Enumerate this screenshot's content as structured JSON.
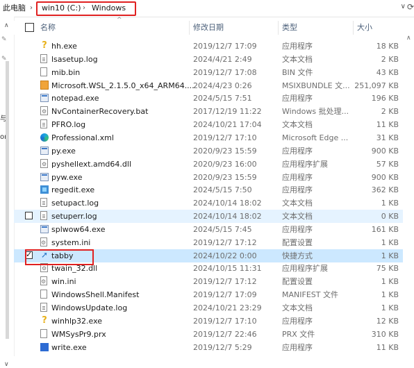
{
  "address": {
    "root": "此电脑",
    "drive": "win10 (C:)",
    "folder": "Windows"
  },
  "navpane": {
    "label1": "与",
    "label2": "on"
  },
  "columns": {
    "name": "名称",
    "date": "修改日期",
    "type": "类型",
    "size": "大小"
  },
  "files": [
    {
      "name": "hh.exe",
      "date": "2019/12/7 17:09",
      "type": "应用程序",
      "size": "18 KB",
      "icon": "help-exe-icon"
    },
    {
      "name": "lsasetup.log",
      "date": "2024/4/21 2:49",
      "type": "文本文档",
      "size": "2 KB",
      "icon": "text-file-icon"
    },
    {
      "name": "mib.bin",
      "date": "2019/12/7 17:08",
      "type": "BIN 文件",
      "size": "43 KB",
      "icon": "file-icon"
    },
    {
      "name": "Microsoft.WSL_2.1.5.0_x64_ARM64....",
      "date": "2024/4/23 0:26",
      "type": "MSIXBUNDLE 文...",
      "size": "251,097 KB",
      "icon": "package-icon"
    },
    {
      "name": "notepad.exe",
      "date": "2024/5/15 7:51",
      "type": "应用程序",
      "size": "196 KB",
      "icon": "app-icon"
    },
    {
      "name": "NvContainerRecovery.bat",
      "date": "2017/12/19 11:22",
      "type": "Windows 批处理...",
      "size": "2 KB",
      "icon": "batch-file-icon"
    },
    {
      "name": "PFRO.log",
      "date": "2024/10/21 17:04",
      "type": "文本文档",
      "size": "11 KB",
      "icon": "text-file-icon"
    },
    {
      "name": "Professional.xml",
      "date": "2019/12/7 17:10",
      "type": "Microsoft Edge ...",
      "size": "31 KB",
      "icon": "edge-icon"
    },
    {
      "name": "py.exe",
      "date": "2020/9/23 15:59",
      "type": "应用程序",
      "size": "900 KB",
      "icon": "python-icon"
    },
    {
      "name": "pyshellext.amd64.dll",
      "date": "2020/9/23 16:00",
      "type": "应用程序扩展",
      "size": "57 KB",
      "icon": "dll-icon"
    },
    {
      "name": "pyw.exe",
      "date": "2020/9/23 15:59",
      "type": "应用程序",
      "size": "900 KB",
      "icon": "python-icon"
    },
    {
      "name": "regedit.exe",
      "date": "2024/5/15 7:50",
      "type": "应用程序",
      "size": "362 KB",
      "icon": "regedit-icon"
    },
    {
      "name": "setupact.log",
      "date": "2024/10/14 18:02",
      "type": "文本文档",
      "size": "1 KB",
      "icon": "text-file-icon"
    },
    {
      "name": "setuperr.log",
      "date": "2024/10/14 18:02",
      "type": "文本文档",
      "size": "0 KB",
      "icon": "text-file-icon"
    },
    {
      "name": "splwow64.exe",
      "date": "2024/5/15 7:45",
      "type": "应用程序",
      "size": "161 KB",
      "icon": "printer-icon"
    },
    {
      "name": "system.ini",
      "date": "2019/12/7 17:12",
      "type": "配置设置",
      "size": "1 KB",
      "icon": "ini-file-icon"
    },
    {
      "name": "tabby",
      "date": "2024/10/22 0:00",
      "type": "快捷方式",
      "size": "1 KB",
      "icon": "shortcut-icon"
    },
    {
      "name": "twain_32.dll",
      "date": "2024/10/15 11:31",
      "type": "应用程序扩展",
      "size": "75 KB",
      "icon": "dll-icon"
    },
    {
      "name": "win.ini",
      "date": "2019/12/7 17:12",
      "type": "配置设置",
      "size": "1 KB",
      "icon": "ini-file-icon"
    },
    {
      "name": "WindowsShell.Manifest",
      "date": "2019/12/7 17:09",
      "type": "MANIFEST 文件",
      "size": "1 KB",
      "icon": "file-icon"
    },
    {
      "name": "WindowsUpdate.log",
      "date": "2024/10/21 23:29",
      "type": "文本文档",
      "size": "1 KB",
      "icon": "text-file-icon"
    },
    {
      "name": "winhlp32.exe",
      "date": "2019/12/7 17:10",
      "type": "应用程序",
      "size": "12 KB",
      "icon": "help-exe-icon"
    },
    {
      "name": "WMSysPr9.prx",
      "date": "2019/12/7 22:46",
      "type": "PRX 文件",
      "size": "310 KB",
      "icon": "file-icon"
    },
    {
      "name": "write.exe",
      "date": "2019/12/7 5:29",
      "type": "应用程序",
      "size": "11 KB",
      "icon": "wordpad-icon"
    }
  ],
  "selected_file": "tabby",
  "hovered_file": "setuperr.log",
  "highlight_color": "#e02020"
}
